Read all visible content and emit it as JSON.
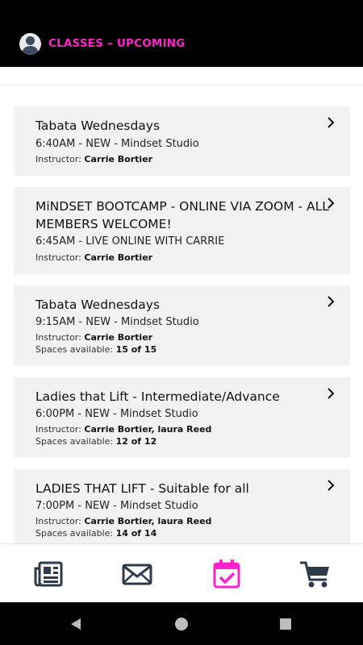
{
  "header": {
    "title": "CLASSES – UPCOMING"
  },
  "classes": [
    {
      "name": "Tabata Wednesdays",
      "time": "6:40AM - NEW - Mindset Studio",
      "instructor_label": "Instructor:",
      "instructor": "Carrie Bortier",
      "spaces_label": "",
      "spaces": ""
    },
    {
      "name": "MiNDSET BOOTCAMP - ONLINE VIA ZOOM - ALL MEMBERS WELCOME!",
      "time": "6:45AM - LIVE ONLINE WITH CARRIE",
      "instructor_label": "Instructor:",
      "instructor": "Carrie Bortier",
      "spaces_label": "",
      "spaces": ""
    },
    {
      "name": "Tabata Wednesdays",
      "time": "9:15AM - NEW - Mindset Studio",
      "instructor_label": "Instructor:",
      "instructor": "Carrie Bortier",
      "spaces_label": "Spaces available:",
      "spaces": "15 of 15"
    },
    {
      "name": "Ladies that Lift - Intermediate/Advance",
      "time": "6:00PM - NEW - Mindset Studio",
      "instructor_label": "Instructor:",
      "instructor": "Carrie Bortier, laura Reed",
      "spaces_label": "Spaces available:",
      "spaces": "12 of 12"
    },
    {
      "name": "LADIES THAT LIFT - Suitable for all",
      "time": "7:00PM - NEW - Mindset Studio",
      "instructor_label": "Instructor:",
      "instructor": "Carrie Bortier, laura Reed",
      "spaces_label": "Spaces available:",
      "spaces": "14 of 14"
    }
  ],
  "tabs": [
    {
      "icon": "news-icon",
      "active": false
    },
    {
      "icon": "mail-icon",
      "active": false
    },
    {
      "icon": "calendar-check-icon",
      "active": true
    },
    {
      "icon": "cart-icon",
      "active": false
    }
  ],
  "colors": {
    "accent": "#ff22cc",
    "header_bg": "#000000",
    "card_bg": "#f2f2f2",
    "icon_dark": "#2d3a4b"
  }
}
